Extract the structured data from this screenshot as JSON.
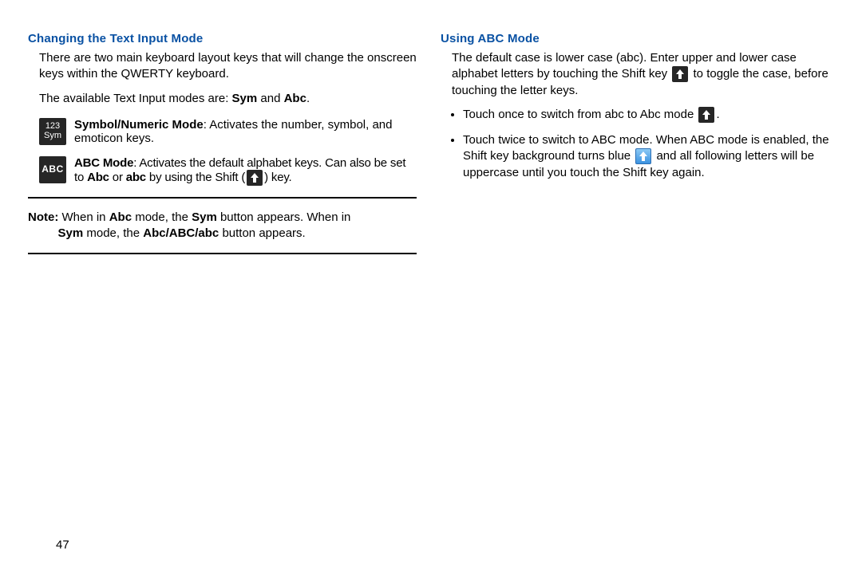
{
  "left": {
    "heading": "Changing the Text Input Mode",
    "para1": "There are two main keyboard layout keys that will change the onscreen keys within the QWERTY keyboard.",
    "para2_pre": "The available Text Input modes are: ",
    "para2_b1": "Sym",
    "para2_mid": " and ",
    "para2_b2": "Abc",
    "para2_end": ".",
    "sym": {
      "icon_l1": "123",
      "icon_l2": "Sym",
      "title": "Symbol/Numeric Mode",
      "desc": ": Activates the number, symbol, and emoticon keys."
    },
    "abc": {
      "icon": "ABC",
      "title": "ABC Mode",
      "desc_a": ": Activates the default alphabet keys. Can also be set to ",
      "desc_b1": "Abc",
      "desc_mid": " or ",
      "desc_b2": "abc",
      "desc_c": " by using the Shift (",
      "desc_d": ") key."
    },
    "note": {
      "label": "Note:",
      "a": " When in ",
      "b1": "Abc",
      "b": " mode, the ",
      "b2": "Sym",
      "c": " button appears. When in ",
      "b3": "Sym",
      "d": " mode, the ",
      "b4": "Abc/ABC/abc",
      "e": " button appears."
    }
  },
  "right": {
    "heading": "Using ABC Mode",
    "para_a": "The default case is lower case (abc). Enter upper and lower case alphabet letters by touching the Shift key ",
    "para_b": " to toggle the case, before touching the letter keys.",
    "bullet1_a": "Touch once to switch from abc to Abc mode ",
    "bullet1_b": ".",
    "bullet2_a": "Touch twice to switch to ABC mode. When ABC mode is enabled, the Shift key background turns blue ",
    "bullet2_b": " and all following letters will be uppercase until you touch the Shift key again."
  },
  "page_number": "47"
}
